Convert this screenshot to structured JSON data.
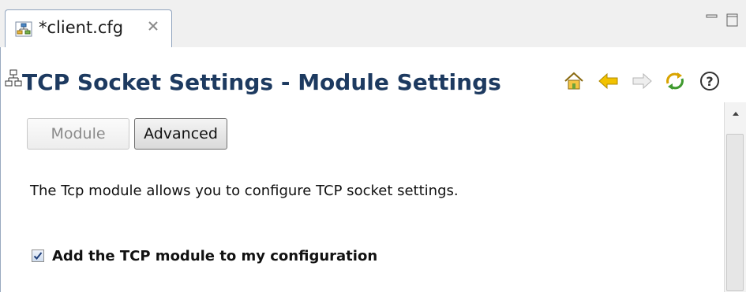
{
  "tab": {
    "label": "*client.cfg",
    "icon": "network-config-icon",
    "close_icon": "close-icon"
  },
  "view_controls": {
    "minimize_icon": "minimize-icon",
    "maximize_icon": "maximize-icon"
  },
  "form": {
    "title": "TCP Socket Settings - Module Settings",
    "title_icon": "network-config-icon",
    "toolbar": [
      "home-icon",
      "back-arrow-icon",
      "forward-arrow-icon",
      "refresh-icon",
      "help-icon"
    ]
  },
  "tabs": {
    "module_label": "Module",
    "advanced_label": "Advanced",
    "module_enabled": false
  },
  "description": "The Tcp module allows you to configure TCP socket settings.",
  "add_module": {
    "label": "Add the TCP module to my configuration",
    "checked": true
  },
  "colors": {
    "title": "#1d3a60",
    "arrow_yellow": "#f2c200",
    "tab_border": "#8fa3bd"
  }
}
